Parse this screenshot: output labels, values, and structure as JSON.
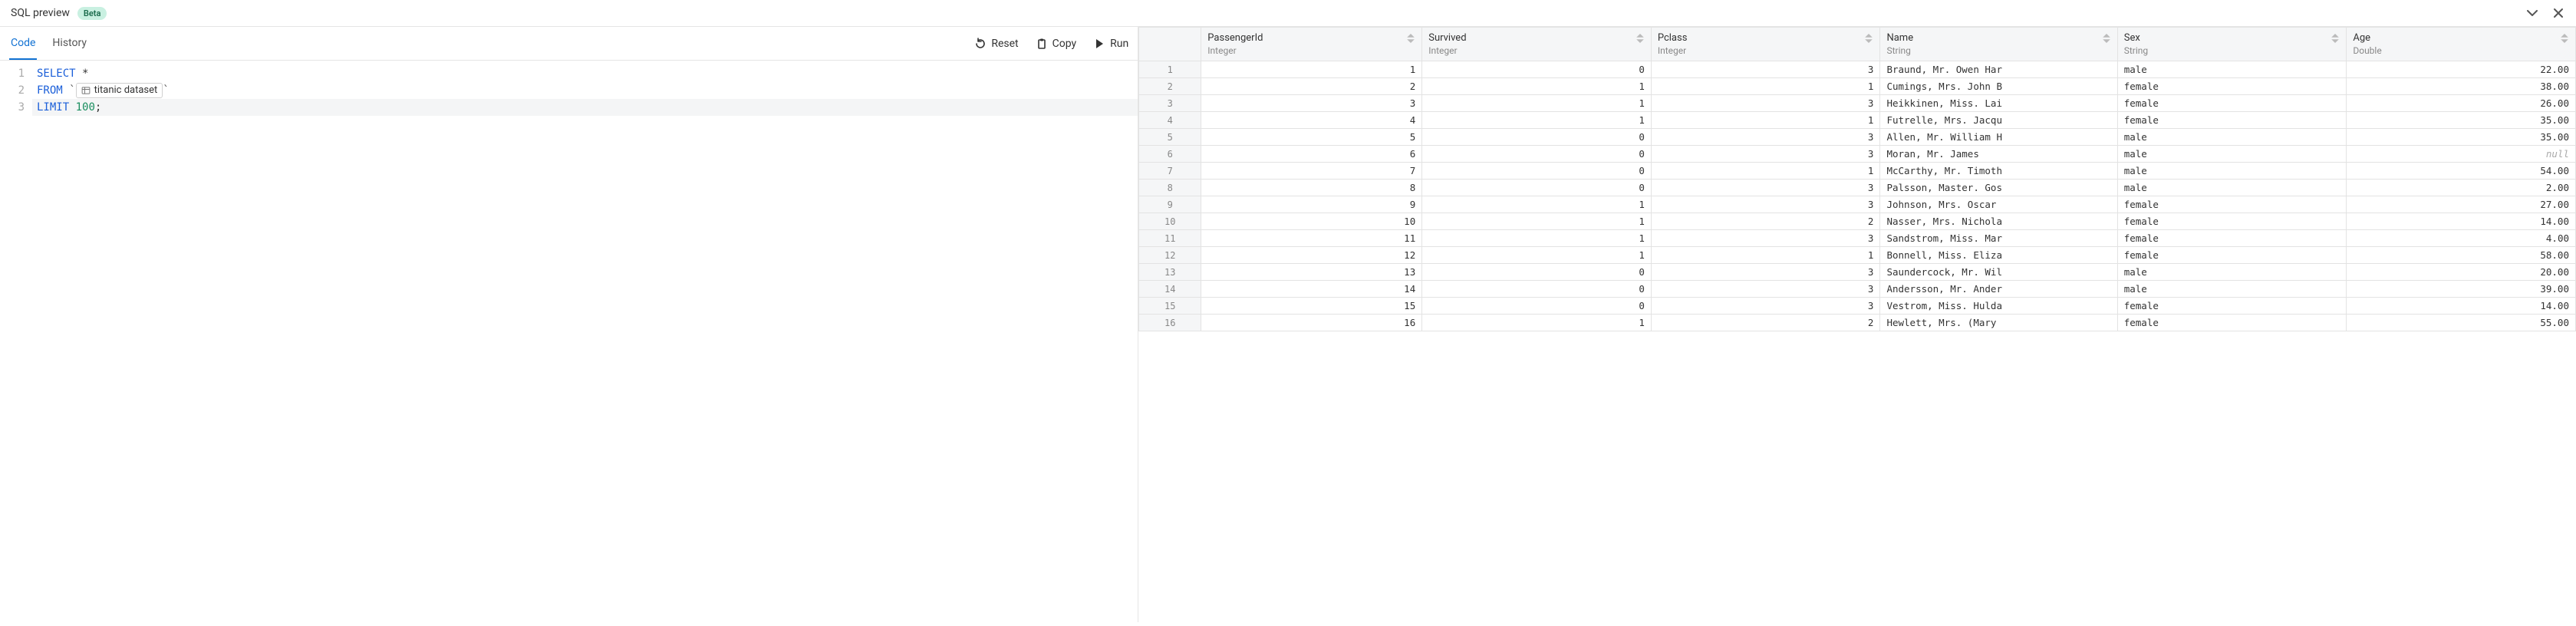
{
  "header": {
    "title": "SQL preview",
    "badge": "Beta"
  },
  "tabs": {
    "code": "Code",
    "history": "History"
  },
  "toolbar": {
    "reset": "Reset",
    "copy": "Copy",
    "run": "Run"
  },
  "sql": {
    "select_kw": "SELECT",
    "star": " *",
    "from_kw": "FROM",
    "dataset_name": "titanic dataset",
    "limit_kw": "LIMIT",
    "limit_val": "100",
    "semi": ";"
  },
  "columns": [
    {
      "name": "PassengerId",
      "type": "Integer",
      "kind": "num"
    },
    {
      "name": "Survived",
      "type": "Integer",
      "kind": "num"
    },
    {
      "name": "Pclass",
      "type": "Integer",
      "kind": "num"
    },
    {
      "name": "Name",
      "type": "String",
      "kind": "str"
    },
    {
      "name": "Sex",
      "type": "String",
      "kind": "str"
    },
    {
      "name": "Age",
      "type": "Double",
      "kind": "num"
    }
  ],
  "rows": [
    {
      "PassengerId": "1",
      "Survived": "0",
      "Pclass": "3",
      "Name": "Braund, Mr. Owen Har",
      "Sex": "male",
      "Age": "22.00"
    },
    {
      "PassengerId": "2",
      "Survived": "1",
      "Pclass": "1",
      "Name": "Cumings, Mrs. John B",
      "Sex": "female",
      "Age": "38.00"
    },
    {
      "PassengerId": "3",
      "Survived": "1",
      "Pclass": "3",
      "Name": "Heikkinen, Miss. Lai",
      "Sex": "female",
      "Age": "26.00"
    },
    {
      "PassengerId": "4",
      "Survived": "1",
      "Pclass": "1",
      "Name": "Futrelle, Mrs. Jacqu",
      "Sex": "female",
      "Age": "35.00"
    },
    {
      "PassengerId": "5",
      "Survived": "0",
      "Pclass": "3",
      "Name": "Allen, Mr. William H",
      "Sex": "male",
      "Age": "35.00"
    },
    {
      "PassengerId": "6",
      "Survived": "0",
      "Pclass": "3",
      "Name": "Moran, Mr. James",
      "Sex": "male",
      "Age": null
    },
    {
      "PassengerId": "7",
      "Survived": "0",
      "Pclass": "1",
      "Name": "McCarthy, Mr. Timoth",
      "Sex": "male",
      "Age": "54.00"
    },
    {
      "PassengerId": "8",
      "Survived": "0",
      "Pclass": "3",
      "Name": "Palsson, Master. Gos",
      "Sex": "male",
      "Age": "2.00"
    },
    {
      "PassengerId": "9",
      "Survived": "1",
      "Pclass": "3",
      "Name": "Johnson, Mrs. Oscar ",
      "Sex": "female",
      "Age": "27.00"
    },
    {
      "PassengerId": "10",
      "Survived": "1",
      "Pclass": "2",
      "Name": "Nasser, Mrs. Nichola",
      "Sex": "female",
      "Age": "14.00"
    },
    {
      "PassengerId": "11",
      "Survived": "1",
      "Pclass": "3",
      "Name": "Sandstrom, Miss. Mar",
      "Sex": "female",
      "Age": "4.00"
    },
    {
      "PassengerId": "12",
      "Survived": "1",
      "Pclass": "1",
      "Name": "Bonnell, Miss. Eliza",
      "Sex": "female",
      "Age": "58.00"
    },
    {
      "PassengerId": "13",
      "Survived": "0",
      "Pclass": "3",
      "Name": "Saundercock, Mr. Wil",
      "Sex": "male",
      "Age": "20.00"
    },
    {
      "PassengerId": "14",
      "Survived": "0",
      "Pclass": "3",
      "Name": "Andersson, Mr. Ander",
      "Sex": "male",
      "Age": "39.00"
    },
    {
      "PassengerId": "15",
      "Survived": "0",
      "Pclass": "3",
      "Name": "Vestrom, Miss. Hulda",
      "Sex": "female",
      "Age": "14.00"
    },
    {
      "PassengerId": "16",
      "Survived": "1",
      "Pclass": "2",
      "Name": "Hewlett, Mrs. (Mary ",
      "Sex": "female",
      "Age": "55.00"
    }
  ],
  "null_label": "null"
}
